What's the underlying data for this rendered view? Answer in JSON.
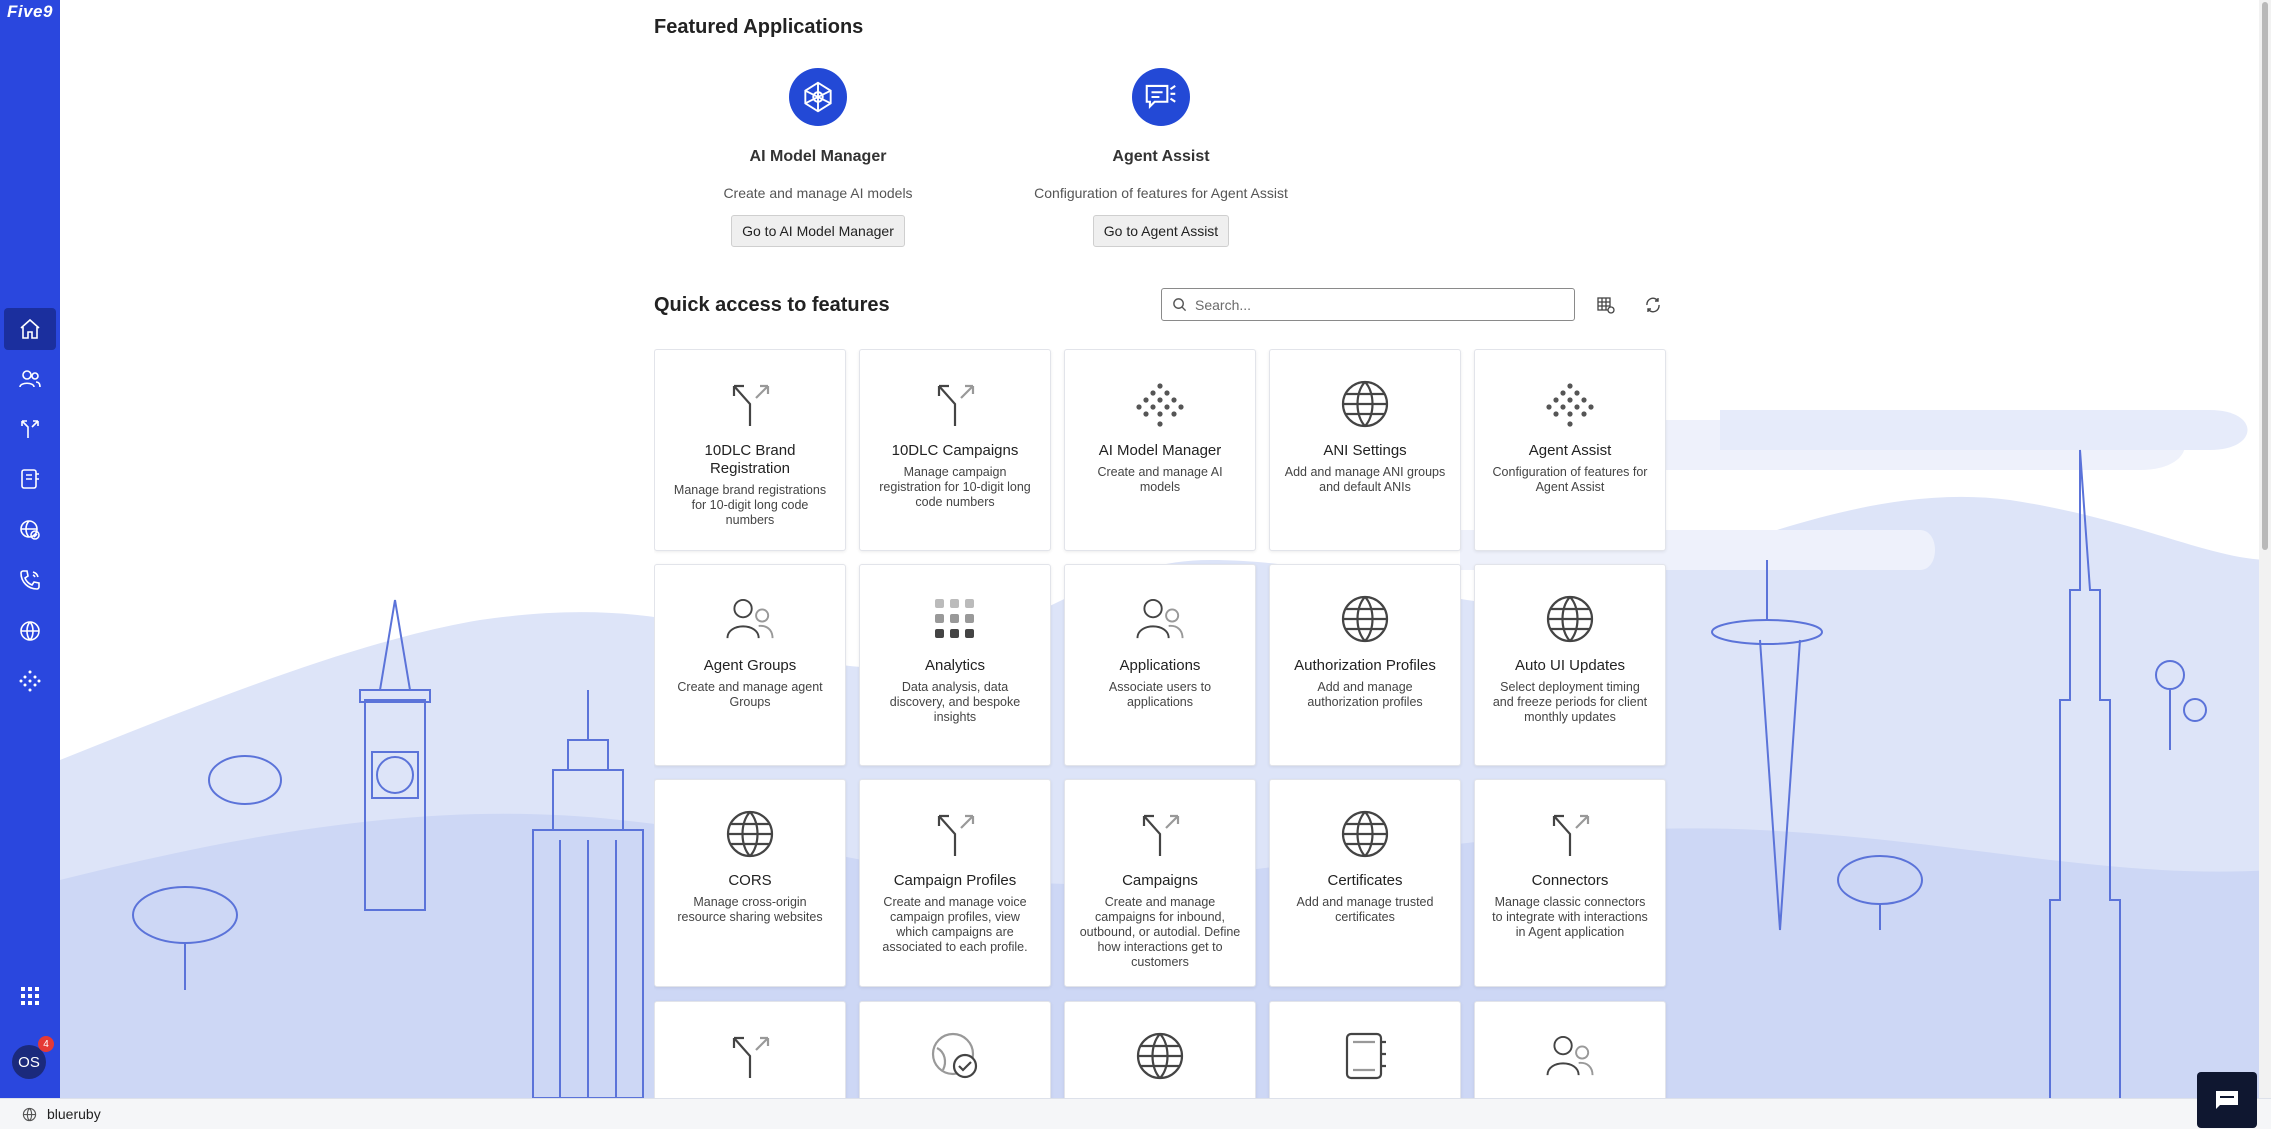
{
  "brand": {
    "logo_text": "Five9"
  },
  "sidebar": {
    "items": [
      {
        "icon": "home-icon",
        "active": true
      },
      {
        "icon": "users-icon"
      },
      {
        "icon": "routing-icon"
      },
      {
        "icon": "contacts-icon"
      },
      {
        "icon": "globe-check-icon"
      },
      {
        "icon": "phone-icon"
      },
      {
        "icon": "globe-icon"
      },
      {
        "icon": "ai-network-icon"
      }
    ],
    "apps_icon": "grid-icon",
    "user_initials": "OS",
    "notification_count": "4"
  },
  "footer": {
    "domain": "blueruby"
  },
  "featured": {
    "title": "Featured Applications",
    "apps": [
      {
        "name": "AI Model Manager",
        "description": "Create and manage AI models",
        "button": "Go to AI Model Manager",
        "icon": "ai-network-icon"
      },
      {
        "name": "Agent Assist",
        "description": "Configuration of features for Agent Assist",
        "button": "Go to Agent Assist",
        "icon": "agent-assist-icon"
      }
    ]
  },
  "quick_access": {
    "title": "Quick access to features",
    "search_placeholder": "Search...",
    "tiles": [
      {
        "name": "10DLC Brand Registration",
        "description": "Manage brand registrations for 10-digit long code numbers",
        "icon": "split-arrow-icon"
      },
      {
        "name": "10DLC Campaigns",
        "description": "Manage campaign registration for 10-digit long code numbers",
        "icon": "split-arrow-icon"
      },
      {
        "name": "AI Model Manager",
        "description": "Create and manage AI models",
        "icon": "dots-diamond-icon"
      },
      {
        "name": "ANI Settings",
        "description": "Add and manage ANI groups and default ANIs",
        "icon": "globe-icon"
      },
      {
        "name": "Agent Assist",
        "description": "Configuration of features for Agent Assist",
        "icon": "dots-diamond-icon"
      },
      {
        "name": "Agent Groups",
        "description": "Create and manage agent Groups",
        "icon": "users-icon"
      },
      {
        "name": "Analytics",
        "description": "Data analysis, data discovery, and bespoke insights",
        "icon": "analytics-grid-icon"
      },
      {
        "name": "Applications",
        "description": "Associate users to applications",
        "icon": "users-icon"
      },
      {
        "name": "Authorization Profiles",
        "description": "Add and manage authorization profiles",
        "icon": "globe-icon"
      },
      {
        "name": "Auto UI Updates",
        "description": "Select deployment timing and freeze periods for client monthly updates",
        "icon": "globe-icon"
      },
      {
        "name": "CORS",
        "description": "Manage cross-origin resource sharing websites",
        "icon": "globe-icon"
      },
      {
        "name": "Campaign Profiles",
        "description": "Create and manage voice campaign profiles, view which campaigns are associated to each profile.",
        "icon": "split-arrow-icon"
      },
      {
        "name": "Campaigns",
        "description": "Create and manage campaigns for inbound, outbound, or autodial. Define how interactions get to customers",
        "icon": "split-arrow-icon"
      },
      {
        "name": "Certificates",
        "description": "Add and manage trusted certificates",
        "icon": "globe-icon"
      },
      {
        "name": "Connectors",
        "description": "Manage classic connectors to integrate with interactions in Agent application",
        "icon": "split-arrow-icon"
      },
      {
        "name": "",
        "description": "",
        "icon": "split-arrow-icon"
      },
      {
        "name": "",
        "description": "",
        "icon": "globe-check-icon"
      },
      {
        "name": "",
        "description": "",
        "icon": "globe-icon"
      },
      {
        "name": "",
        "description": "",
        "icon": "contacts-icon"
      },
      {
        "name": "",
        "description": "",
        "icon": "users-icon"
      }
    ]
  },
  "colors": {
    "sidebar": "#2a47de",
    "sidebar_active": "#1b2f9e",
    "accent": "#2349d6",
    "illustration": "#c5d1f3"
  }
}
